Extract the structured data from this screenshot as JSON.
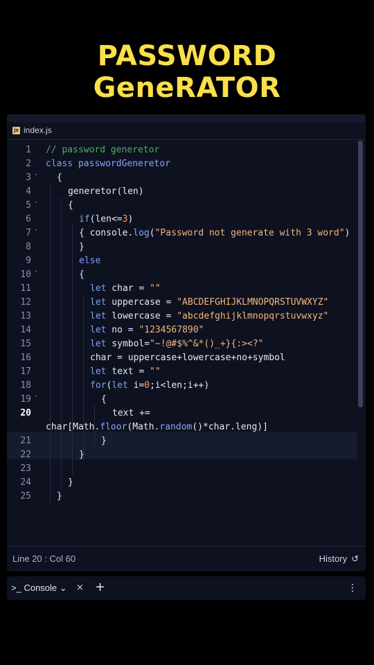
{
  "title": "PASSWORD GeneRATOR",
  "editor": {
    "file_icon": "js",
    "file_name": "index.js",
    "line_numbers": [
      "1",
      "2",
      "3",
      "4",
      "5",
      "6",
      "7",
      "8",
      "9",
      "10",
      "11",
      "12",
      "13",
      "14",
      "15",
      "16",
      "17",
      "18",
      "19",
      "20",
      "",
      "21",
      "22",
      "23",
      "24",
      "25"
    ],
    "active_line_number": "20",
    "fold_markers": {
      "line3": "˅",
      "line5": "˅",
      "line7": "˅",
      "line10": "˅",
      "line19": "˅"
    },
    "code": {
      "l1_comment": "// password generetor",
      "l2_kw": "class",
      "l2_name": " passwordGeneretor",
      "l3": "{",
      "l4_fn": "generetor",
      "l4_rest": "(len)",
      "l5": "{",
      "l6_kw": "if",
      "l6_a": "(len<=",
      "l6_num": "3",
      "l6_b": ")",
      "l7_a": "{ console.",
      "l7_fn": "log",
      "l7_b": "(",
      "l7_str": "\"Password not generate with 3 word\"",
      "l7_c": ")",
      "l8": "}",
      "l9_kw": "else",
      "l10": "{",
      "l11_kw": "let",
      "l11_a": " char = ",
      "l11_str": "\"\"",
      "l12_kw": "let",
      "l12_a": " uppercase = ",
      "l12_str": "\"ABCDEFGHIJKLMNOPQRSTUVWXYZ\"",
      "l13_kw": "let",
      "l13_a": " lowercase = ",
      "l13_str": "\"abcdefghijklmnopqrstuvwxyz\"",
      "l14_kw": "let",
      "l14_a": " no = ",
      "l14_str": "\"1234567890\"",
      "l15_kw": "let",
      "l15_a": " symbol=",
      "l15_str": "\"~!@#$%^&*()_+}{:><?\"",
      "l16": "char = uppercase+lowercase+no+symbol",
      "l17_kw": "let",
      "l17_a": " text = ",
      "l17_str": "\"\"",
      "l18_kw1": "for",
      "l18_a": "(",
      "l18_kw2": "let",
      "l18_b": " i=",
      "l18_num": "0",
      "l18_c": ";i<len;i++)",
      "l19": "{",
      "l20": "text +=",
      "l20w_a": "char[Math.",
      "l20w_fn1": "floor",
      "l20w_b": "(Math.",
      "l20w_fn2": "random",
      "l20w_c": "()*char.leng)]",
      "l21": "}",
      "l22": "}",
      "l24": "}",
      "l25": "}"
    }
  },
  "status": {
    "position": "Line 20 : Col 60",
    "history_label": "History",
    "history_icon": "history-icon"
  },
  "console": {
    "prompt_icon": ">_",
    "tab_label": "Console",
    "chevron": "⌄",
    "close": "×",
    "add": "+",
    "menu": "⋮"
  }
}
